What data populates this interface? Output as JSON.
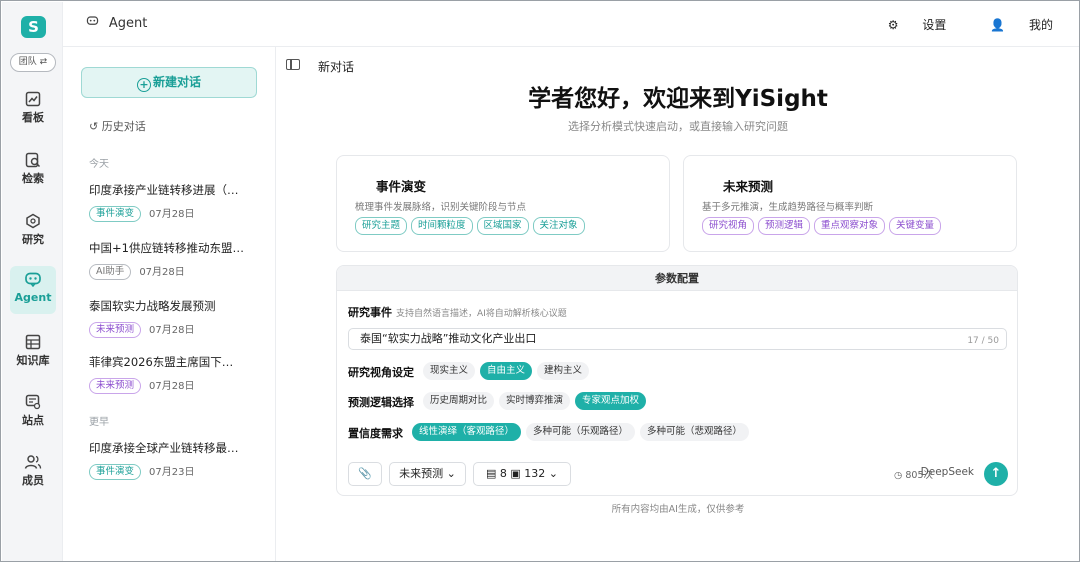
{
  "app": {
    "logo_text": "S"
  },
  "rail": {
    "team_label": "团队 ⇄",
    "items": [
      {
        "label": "看板",
        "icon": "chart-icon"
      },
      {
        "label": "检索",
        "icon": "search-doc-icon"
      },
      {
        "label": "研究",
        "icon": "research-icon"
      },
      {
        "label": "Agent",
        "icon": "agent-icon"
      },
      {
        "label": "知识库",
        "icon": "knowledge-icon"
      },
      {
        "label": "站点",
        "icon": "site-icon"
      },
      {
        "label": "成员",
        "icon": "members-icon"
      }
    ],
    "active": "Agent"
  },
  "header": {
    "title": "Agent",
    "settings_label": "设置",
    "profile_label": "我的"
  },
  "history": {
    "new_chat_label": "新建对话",
    "history_label": "历史对话",
    "group_today": "今天",
    "group_earlier": "更早",
    "items": [
      {
        "title": "印度承接产业链转移进展（…",
        "tag": "事件演变",
        "date": "07月28日"
      },
      {
        "title": "中国+1供应链转移推动东盟…",
        "tag": "AI助手",
        "date": "07月28日"
      },
      {
        "title": "泰国软实力战略发展预测",
        "tag": "未来预测",
        "date": "07月28日"
      },
      {
        "title": "菲律宾2026东盟主席国下…",
        "tag": "未来预测",
        "date": "07月28日"
      },
      {
        "title": "印度承接全球产业链转移最…",
        "tag": "事件演变",
        "date": "07月23日"
      }
    ]
  },
  "main": {
    "page_title": "新对话",
    "welcome": "学者您好，欢迎来到YiSight",
    "subtitle": "选择分析模式快速启动，或直接输入研究问题",
    "cards": [
      {
        "title": "事件演变",
        "desc": "梳理事件发展脉络，识别关键阶段与节点",
        "tags": [
          "研究主题",
          "时间颗粒度",
          "区域国家",
          "关注对象"
        ]
      },
      {
        "title": "未来预测",
        "desc": "基于多元推演，生成趋势路径与概率判断",
        "tags": [
          "研究视角",
          "预测逻辑",
          "重点观察对象",
          "关键变量"
        ]
      }
    ],
    "params": {
      "header": "参数配置",
      "event_label": "研究事件",
      "event_hint": "支持自然语言描述，AI将自动解析核心议题",
      "event_value": "泰国“软实力战略”推动文化产业出口",
      "event_count": "17 / 50",
      "perspective_label": "研究视角设定",
      "perspective_options": [
        "现实主义",
        "自由主义",
        "建构主义"
      ],
      "perspective_selected": "自由主义",
      "logic_label": "预测逻辑选择",
      "logic_options": [
        "历史周期对比",
        "实时博弈推演",
        "专家观点加权"
      ],
      "logic_selected": "专家观点加权",
      "confidence_label": "置信度需求",
      "confidence_options": [
        "线性演绎（客观路径）",
        "多种可能（乐观路径）",
        "多种可能（悲观路径）"
      ],
      "confidence_selected": "线性演绎（客观路径）"
    },
    "toolbar": {
      "mode": "未来预测",
      "doc_count": "8",
      "img_count": "132",
      "usage": "805次",
      "model": "DeepSeek"
    },
    "disclaimer": "所有内容均由AI生成，仅供参考"
  },
  "colors": {
    "accent": "#1fb0a8",
    "purple": "#8c4fcf"
  }
}
